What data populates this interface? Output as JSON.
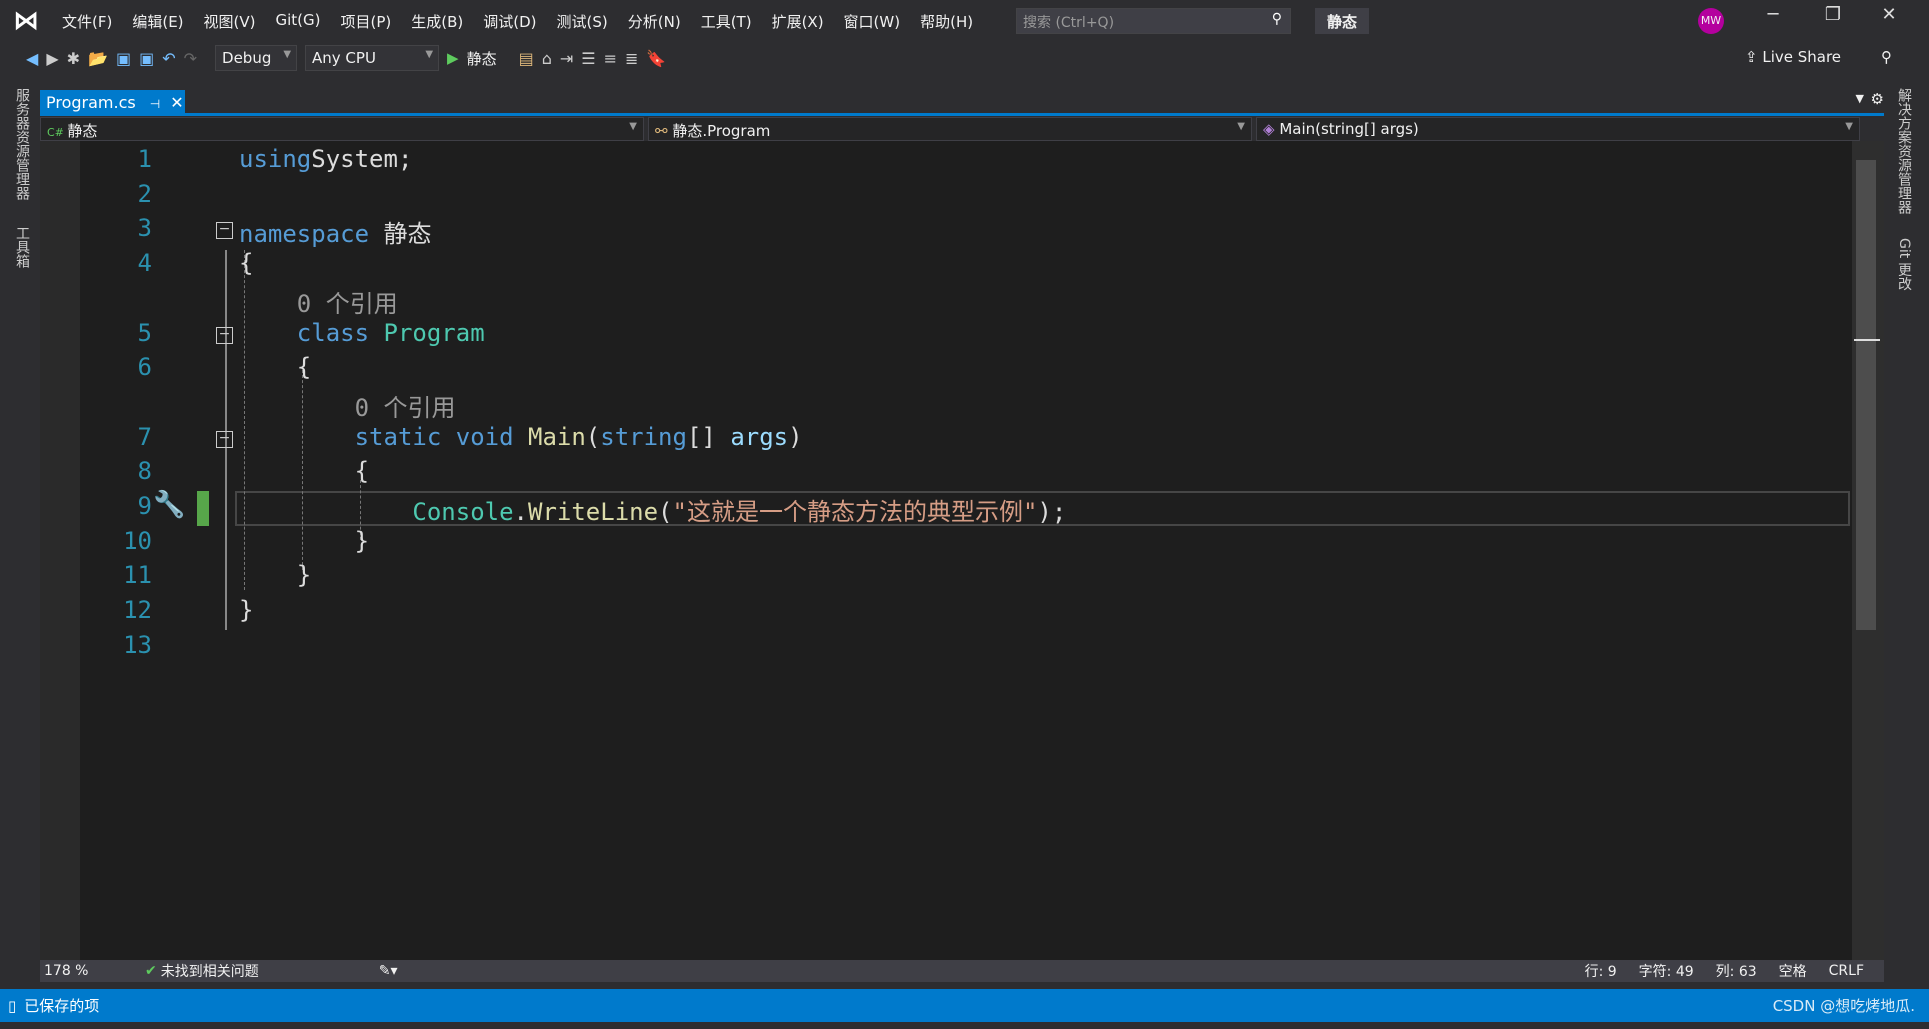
{
  "title_bar": {
    "menus": [
      "文件(F)",
      "编辑(E)",
      "视图(V)",
      "Git(G)",
      "项目(P)",
      "生成(B)",
      "调试(D)",
      "测试(S)",
      "分析(N)",
      "工具(T)",
      "扩展(X)",
      "窗口(W)",
      "帮助(H)"
    ],
    "search_placeholder": "搜索 (Ctrl+Q)",
    "solution_name": "静态",
    "avatar_initials": "MW"
  },
  "toolbar": {
    "configuration": "Debug",
    "platform": "Any CPU",
    "start_label": "静态",
    "live_share": "Live Share"
  },
  "left_panel": {
    "items": [
      "服务器资源管理器",
      "工具箱"
    ]
  },
  "right_panel": {
    "items": [
      "解决方案资源管理器",
      "Git 更改"
    ]
  },
  "tab": {
    "label": "Program.cs"
  },
  "navbar": {
    "project": "静态",
    "class": "静态.Program",
    "member": "Main(string[] args)"
  },
  "code": [
    {
      "n": "1",
      "t": [
        [
          "kw",
          "using"
        ],
        [
          "",
          "System;"
        ]
      ]
    },
    {
      "n": "2",
      "t": []
    },
    {
      "n": "3",
      "t": [
        [
          "kw",
          "namespace"
        ],
        [
          "",
          " 静态"
        ]
      ],
      "fold": true
    },
    {
      "n": "4",
      "t": [
        [
          "",
          "{"
        ]
      ]
    },
    {
      "n": "",
      "t": [
        [
          "lens",
          "    0 个引用"
        ]
      ]
    },
    {
      "n": "5",
      "t": [
        [
          "kw",
          "    class"
        ],
        [
          "ty",
          " Program"
        ]
      ],
      "fold": true
    },
    {
      "n": "6",
      "t": [
        [
          "",
          "    {"
        ]
      ]
    },
    {
      "n": "",
      "t": [
        [
          "lens",
          "        0 个引用"
        ]
      ]
    },
    {
      "n": "7",
      "t": [
        [
          "kw",
          "        static void"
        ],
        [
          "fn",
          " Main"
        ],
        [
          "",
          "("
        ],
        [
          "kw",
          "string"
        ],
        [
          "",
          "[] "
        ],
        [
          "pm",
          "args"
        ],
        [
          "",
          ")"
        ]
      ],
      "fold": true
    },
    {
      "n": "8",
      "t": [
        [
          "",
          "        {"
        ]
      ]
    },
    {
      "n": "9",
      "t": [
        [
          "ty",
          "            Console"
        ],
        [
          "",
          "."
        ],
        [
          "fn",
          "WriteLine"
        ],
        [
          "",
          "("
        ],
        [
          "st",
          "\"这就是一个静态方法的典型示例\""
        ],
        [
          "",
          ");"
        ]
      ]
    },
    {
      "n": "10",
      "t": [
        [
          "",
          "        }"
        ]
      ]
    },
    {
      "n": "11",
      "t": [
        [
          "",
          "    }"
        ]
      ]
    },
    {
      "n": "12",
      "t": [
        [
          "",
          "}"
        ]
      ]
    },
    {
      "n": "13",
      "t": []
    }
  ],
  "editor_status": {
    "zoom": "178 %",
    "issues": "未找到相关问题",
    "line": "行: 9",
    "char": "字符: 49",
    "col": "列: 63",
    "whitespace": "空格",
    "eol": "CRLF"
  },
  "status_bar": {
    "message": "已保存的项",
    "watermark": "CSDN @想吃烤地瓜."
  }
}
